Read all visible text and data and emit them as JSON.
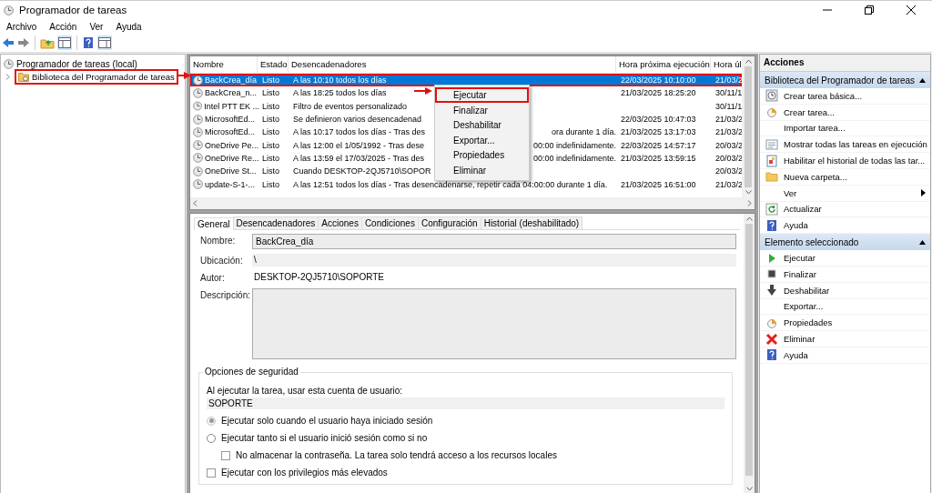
{
  "window": {
    "title": "Programador de tareas"
  },
  "menu": [
    "Archivo",
    "Acción",
    "Ver",
    "Ayuda"
  ],
  "tree": {
    "label": "Programador de tareas (local)",
    "children": [
      {
        "label": "Biblioteca del Programador de tareas",
        "annotated": true,
        "expanded": false
      }
    ]
  },
  "table": {
    "columns": [
      "Nombre",
      "Estado",
      "Desencadenadores",
      "Hora próxima ejecución",
      "Hora úl"
    ],
    "rows": [
      {
        "name": "BackCrea_día",
        "status": "Listo",
        "trigger": "A las 10:10 todos los días",
        "trigger_end": "",
        "next_run": "22/03/2025 10:10:00",
        "last_run": "21/03/2",
        "selected": true,
        "annotated": true
      },
      {
        "name": "BackCrea_n...",
        "status": "Listo",
        "trigger": "A las 18:25 todos los días",
        "trigger_end": "",
        "next_run": "21/03/2025 18:25:20",
        "last_run": "30/11/1",
        "selected": false,
        "annotated": false
      },
      {
        "name": "Intel PTT EK ...",
        "status": "Listo",
        "trigger": "Filtro de eventos personalizado",
        "trigger_end": "",
        "next_run": "",
        "last_run": "30/11/1",
        "selected": false,
        "annotated": false
      },
      {
        "name": "MicrosoftEd...",
        "status": "Listo",
        "trigger": "Se definieron varios desencadenad",
        "trigger_end": "",
        "next_run": "22/03/2025 10:47:03",
        "last_run": "21/03/2",
        "selected": false,
        "annotated": false
      },
      {
        "name": "MicrosoftEd...",
        "status": "Listo",
        "trigger": "A las 10:17 todos los días - Tras des",
        "trigger_end": "ora durante 1 día.",
        "next_run": "21/03/2025 13:17:03",
        "last_run": "21/03/2",
        "selected": false,
        "annotated": false
      },
      {
        "name": "OneDrive Pe...",
        "status": "Listo",
        "trigger": "A las 12:00 el 1/05/1992 - Tras dese",
        "trigger_end": "00:00 indefinidamente.",
        "next_run": "22/03/2025 14:57:17",
        "last_run": "20/03/2",
        "selected": false,
        "annotated": false
      },
      {
        "name": "OneDrive Re...",
        "status": "Listo",
        "trigger": "A las 13:59 el 17/03/2025 - Tras des",
        "trigger_end": "00:00 indefinidamente.",
        "next_run": "21/03/2025 13:59:15",
        "last_run": "20/03/2",
        "selected": false,
        "annotated": false
      },
      {
        "name": "OneDrive St...",
        "status": "Listo",
        "trigger": "Cuando DESKTOP-2QJ5710\\SOPOR",
        "trigger_end": "",
        "next_run": "",
        "last_run": "20/03/2",
        "selected": false,
        "annotated": false
      },
      {
        "name": "update-S-1-...",
        "status": "Listo",
        "trigger": "A las 12:51 todos los días - Tras desencadenarse, repetir cada 04:00:00 durante 1 día.",
        "trigger_end": "",
        "next_run": "21/03/2025 16:51:00",
        "last_run": "21/03/2",
        "selected": false,
        "annotated": false
      }
    ]
  },
  "context_menu": [
    {
      "label": "Ejecutar",
      "annotated": true
    },
    {
      "label": "Finalizar",
      "annotated": false
    },
    {
      "label": "Deshabilitar",
      "annotated": false
    },
    {
      "label": "Exportar...",
      "annotated": false
    },
    {
      "label": "Propiedades",
      "annotated": false
    },
    {
      "label": "Eliminar",
      "annotated": false
    }
  ],
  "details": {
    "tabs": [
      {
        "label": "General",
        "selected": true
      },
      {
        "label": "Desencadenadores",
        "selected": false
      },
      {
        "label": "Acciones",
        "selected": false
      },
      {
        "label": "Condiciones",
        "selected": false
      },
      {
        "label": "Configuración",
        "selected": false
      },
      {
        "label": "Historial (deshabilitado)",
        "selected": false
      }
    ],
    "name_label": "Nombre:",
    "name": "BackCrea_día",
    "location_label": "Ubicación:",
    "location": "\\",
    "author_label": "Autor:",
    "author": "DESKTOP-2QJ5710\\SOPORTE",
    "description_label": "Descripción:",
    "security": {
      "title": "Opciones de seguridad",
      "account_label": "Al ejecutar la tarea, usar esta cuenta de usuario:",
      "account": "SOPORTE",
      "options": [
        {
          "kind": "radio",
          "label": "Ejecutar solo cuando el usuario haya iniciado sesión",
          "selected": true,
          "disabled": true
        },
        {
          "kind": "radio",
          "label": "Ejecutar tanto si el usuario inició sesión como si no",
          "selected": false,
          "disabled": false
        },
        {
          "kind": "subcheckbox",
          "label": "No almacenar la contraseña. La tarea solo tendrá acceso a los recursos locales",
          "checked": false
        },
        {
          "kind": "checkbox",
          "label": "Ejecutar con los privilegios más elevados",
          "checked": false
        }
      ]
    }
  },
  "actions": {
    "title": "Acciones",
    "sections": [
      {
        "title": "Biblioteca del Programador de tareas",
        "expanded": true,
        "items": [
          {
            "label": "Crear tarea básica...",
            "kind": "clock"
          },
          {
            "label": "Crear tarea...",
            "kind": "task"
          },
          {
            "label": "Importar tarea...",
            "kind": "none"
          },
          {
            "label": "Mostrar todas las tareas en ejecución",
            "kind": "list"
          },
          {
            "label": "Habilitar el historial de todas las tar...",
            "kind": "history"
          },
          {
            "label": "Nueva carpeta...",
            "kind": "folder"
          },
          {
            "label": "Ver",
            "kind": "submenu"
          },
          {
            "label": "Actualizar",
            "kind": "refresh"
          },
          {
            "label": "Ayuda",
            "kind": "help"
          }
        ]
      },
      {
        "title": "Elemento seleccionado",
        "expanded": true,
        "items": [
          {
            "label": "Ejecutar",
            "kind": "play"
          },
          {
            "label": "Finalizar",
            "kind": "stop"
          },
          {
            "label": "Deshabilitar",
            "kind": "down"
          },
          {
            "label": "Exportar...",
            "kind": "none"
          },
          {
            "label": "Propiedades",
            "kind": "task"
          },
          {
            "label": "Eliminar",
            "kind": "delete"
          },
          {
            "label": "Ayuda",
            "kind": "help"
          }
        ]
      }
    ]
  }
}
